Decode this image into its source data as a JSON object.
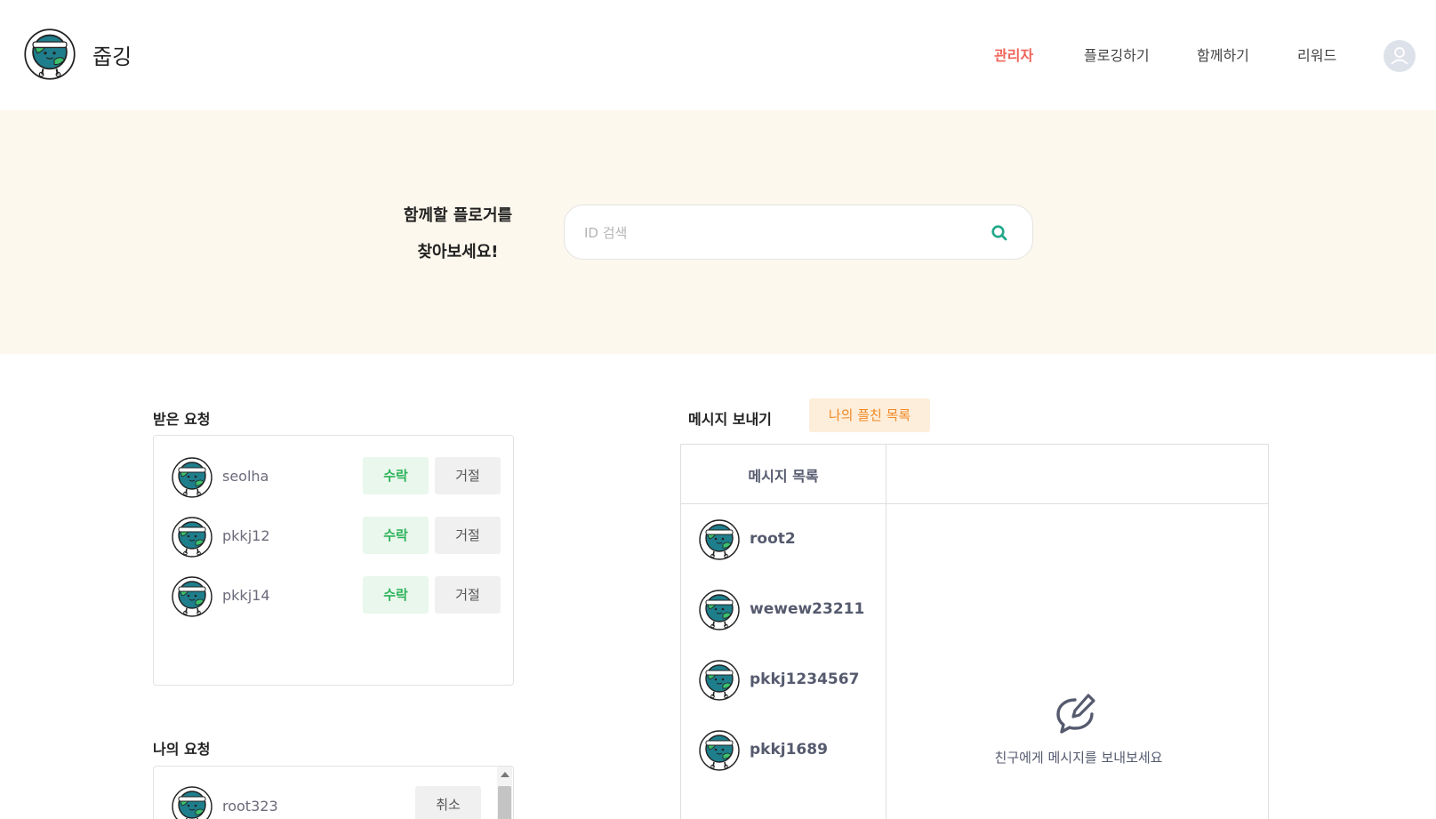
{
  "header": {
    "brand": "줍깅",
    "nav": [
      "관리자",
      "플로깅하기",
      "함께하기",
      "리워드"
    ],
    "active_nav": "관리자"
  },
  "hero": {
    "title_line1": "함께할 플로거를",
    "title_line2": "찾아보세요!",
    "search_placeholder": "ID 검색"
  },
  "received": {
    "title": "받은 요청",
    "accept_label": "수락",
    "reject_label": "거절",
    "items": [
      {
        "name": "seolha"
      },
      {
        "name": "pkkj12"
      },
      {
        "name": "pkkj14"
      }
    ]
  },
  "my_requests": {
    "title": "나의 요청",
    "cancel_label": "취소",
    "items": [
      {
        "name": "root323"
      }
    ]
  },
  "message": {
    "title": "메시지 보내기",
    "friends_tab": "나의 플친 목록",
    "list_title": "메시지 목록",
    "friends": [
      "root2",
      "wewew23211",
      "pkkj1234567",
      "pkkj1689"
    ],
    "empty_text": "친구에게 메시지를 보내보세요"
  },
  "colors": {
    "accent": "#f0645a",
    "hero_bg": "#fdf8ed",
    "accept_bg": "#e9f7ec",
    "accept_text": "#2db35a",
    "tab_bg": "#fdeedb",
    "tab_text": "#f08a24",
    "search_icon": "#21a88a"
  },
  "icons": {
    "logo": "earth-mascot-logo",
    "profile": "user-avatar-icon",
    "search": "search-icon",
    "compose": "compose-message-icon"
  }
}
